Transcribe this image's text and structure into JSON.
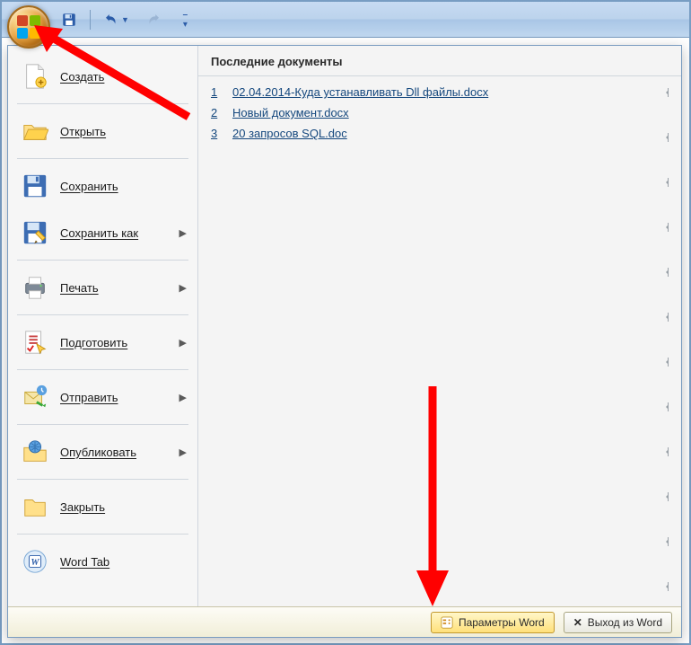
{
  "qat": {
    "save_tooltip": "Сохранить",
    "undo_tooltip": "Отменить",
    "redo_tooltip": "Повторить"
  },
  "menu": {
    "items": [
      {
        "label": "Создать",
        "submenu": false
      },
      {
        "label": "Открыть",
        "submenu": false
      },
      {
        "label": "Сохранить",
        "submenu": false
      },
      {
        "label": "Сохранить как",
        "submenu": true
      },
      {
        "label": "Печать",
        "submenu": true
      },
      {
        "label": "Подготовить",
        "submenu": true
      },
      {
        "label": "Отправить",
        "submenu": true
      },
      {
        "label": "Опубликовать",
        "submenu": true
      },
      {
        "label": "Закрыть",
        "submenu": false
      },
      {
        "label": "Word Tab",
        "submenu": false
      }
    ]
  },
  "recent": {
    "header": "Последние документы",
    "docs": [
      {
        "num": "1",
        "name": "02.04.2014-Куда устанавливать Dll файлы.docx"
      },
      {
        "num": "2",
        "name": "Новый документ.docx"
      },
      {
        "num": "3",
        "name": "20 запросов SQL.doc"
      }
    ]
  },
  "footer": {
    "options": "Параметры Word",
    "exit": "Выход из Word"
  }
}
